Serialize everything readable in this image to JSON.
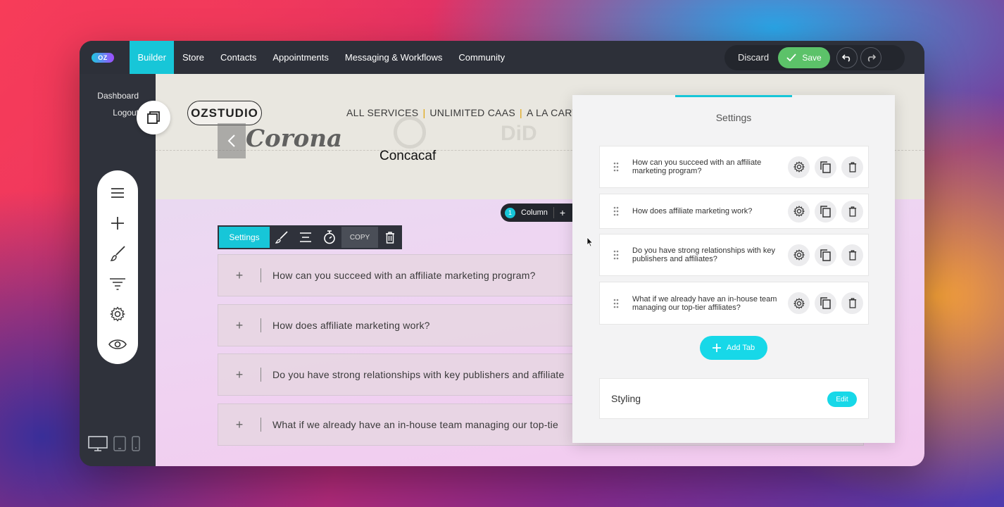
{
  "topbar": {
    "logo": "OZ",
    "nav": [
      "Builder",
      "Store",
      "Contacts",
      "Appointments",
      "Messaging & Workflows",
      "Community"
    ],
    "discard": "Discard",
    "save": "Save"
  },
  "sidebar": {
    "links": [
      "Dashboard",
      "Logout"
    ],
    "tools": [
      "menu-icon",
      "plus-icon",
      "brush-icon",
      "filter-icon",
      "gear-icon",
      "eye-icon"
    ],
    "devices": [
      "desktop-icon",
      "tablet-icon",
      "mobile-icon"
    ]
  },
  "site": {
    "logo": "OZSTUDIO",
    "menu": [
      "ALL SERVICES",
      "UNLIMITED CAAS",
      "A LA CARTE S"
    ],
    "brands": [
      "Corona",
      "Concacaf",
      "DiD"
    ]
  },
  "column_chip": {
    "number": "1",
    "label": "Column",
    "plus": "+"
  },
  "element_toolbar": {
    "settings": "Settings",
    "copy": "COPY"
  },
  "accordion": [
    "How can you succeed with an affiliate marketing program?",
    "How does affiliate marketing work?",
    "Do you have strong relationships with key publishers and affiliate",
    "What if we already have an in-house team managing our top-tie"
  ],
  "panel": {
    "title": "Settings",
    "tabs": [
      "How can you succeed with an affiliate marketing program?",
      "How does affiliate marketing work?",
      "Do you have strong relationships with key publishers and affiliates?",
      "What if we already have an in-house team managing our top-tier affiliates?"
    ],
    "add_tab": "Add Tab",
    "styling": "Styling",
    "edit": "Edit"
  },
  "colors": {
    "accent": "#17c6d8",
    "save": "#5cc269",
    "chrome": "#2f323b"
  }
}
